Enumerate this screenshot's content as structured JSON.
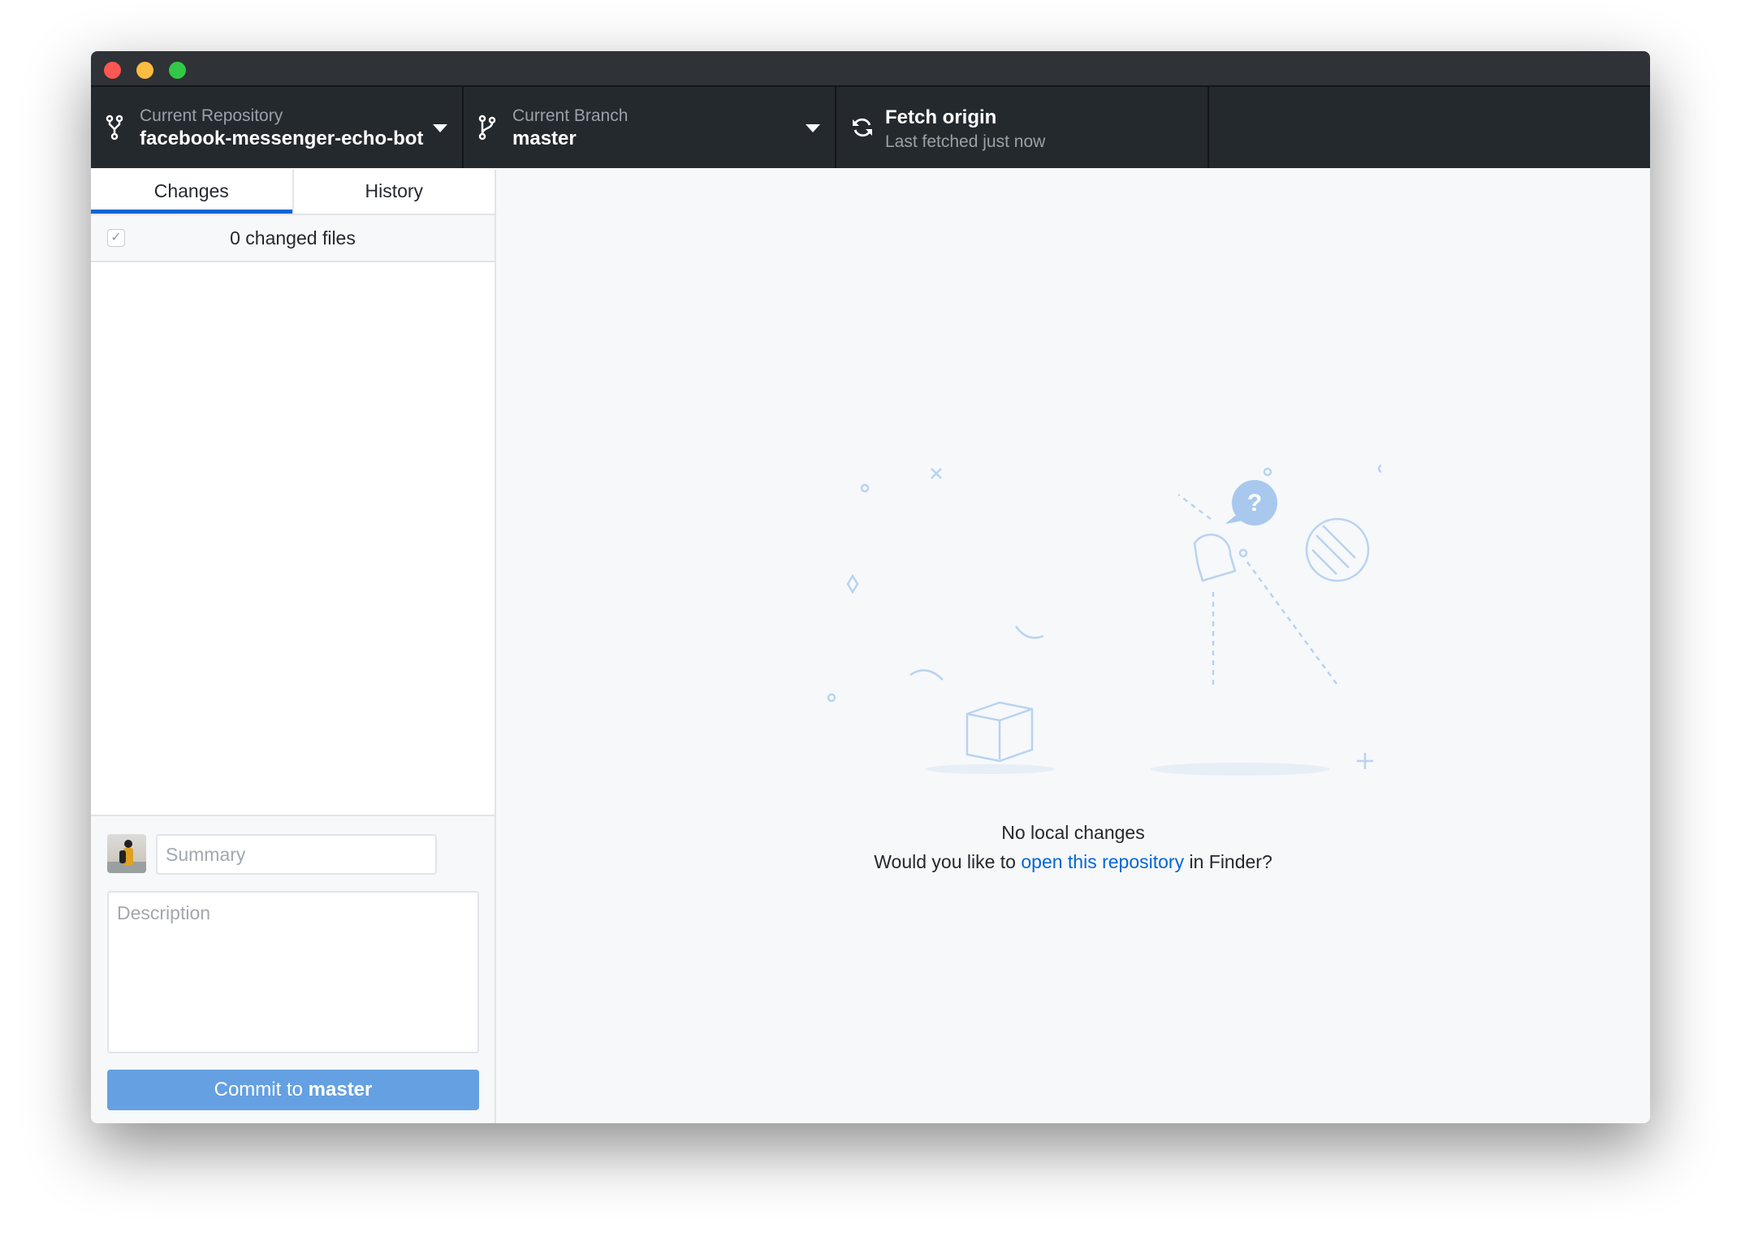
{
  "window": {
    "controls": [
      "close",
      "minimize",
      "maximize"
    ],
    "colors": {
      "close": "#fc5753",
      "minimize": "#fdbc40",
      "maximize": "#33c748"
    }
  },
  "toolbar": {
    "repository": {
      "label": "Current Repository",
      "value": "facebook-messenger-echo-bot",
      "icon": "repo-icon"
    },
    "branch": {
      "label": "Current Branch",
      "value": "master",
      "icon": "branch-icon"
    },
    "fetch": {
      "label": "Fetch origin",
      "value": "Last fetched just now",
      "icon": "sync-icon"
    }
  },
  "sidebar": {
    "tabs": [
      {
        "label": "Changes",
        "active": true
      },
      {
        "label": "History",
        "active": false
      }
    ],
    "changed_files": "0 changed files",
    "commit": {
      "summary_placeholder": "Summary",
      "description_placeholder": "Description",
      "button_prefix": "Commit to",
      "button_branch": "master"
    }
  },
  "main": {
    "title": "No local changes",
    "prompt_before": "Would you like to",
    "link": "open this repository",
    "prompt_after": "in Finder?"
  },
  "colors": {
    "accent": "#0366d6",
    "toolbar": "#24292e",
    "commit_button": "#64a0e2"
  }
}
